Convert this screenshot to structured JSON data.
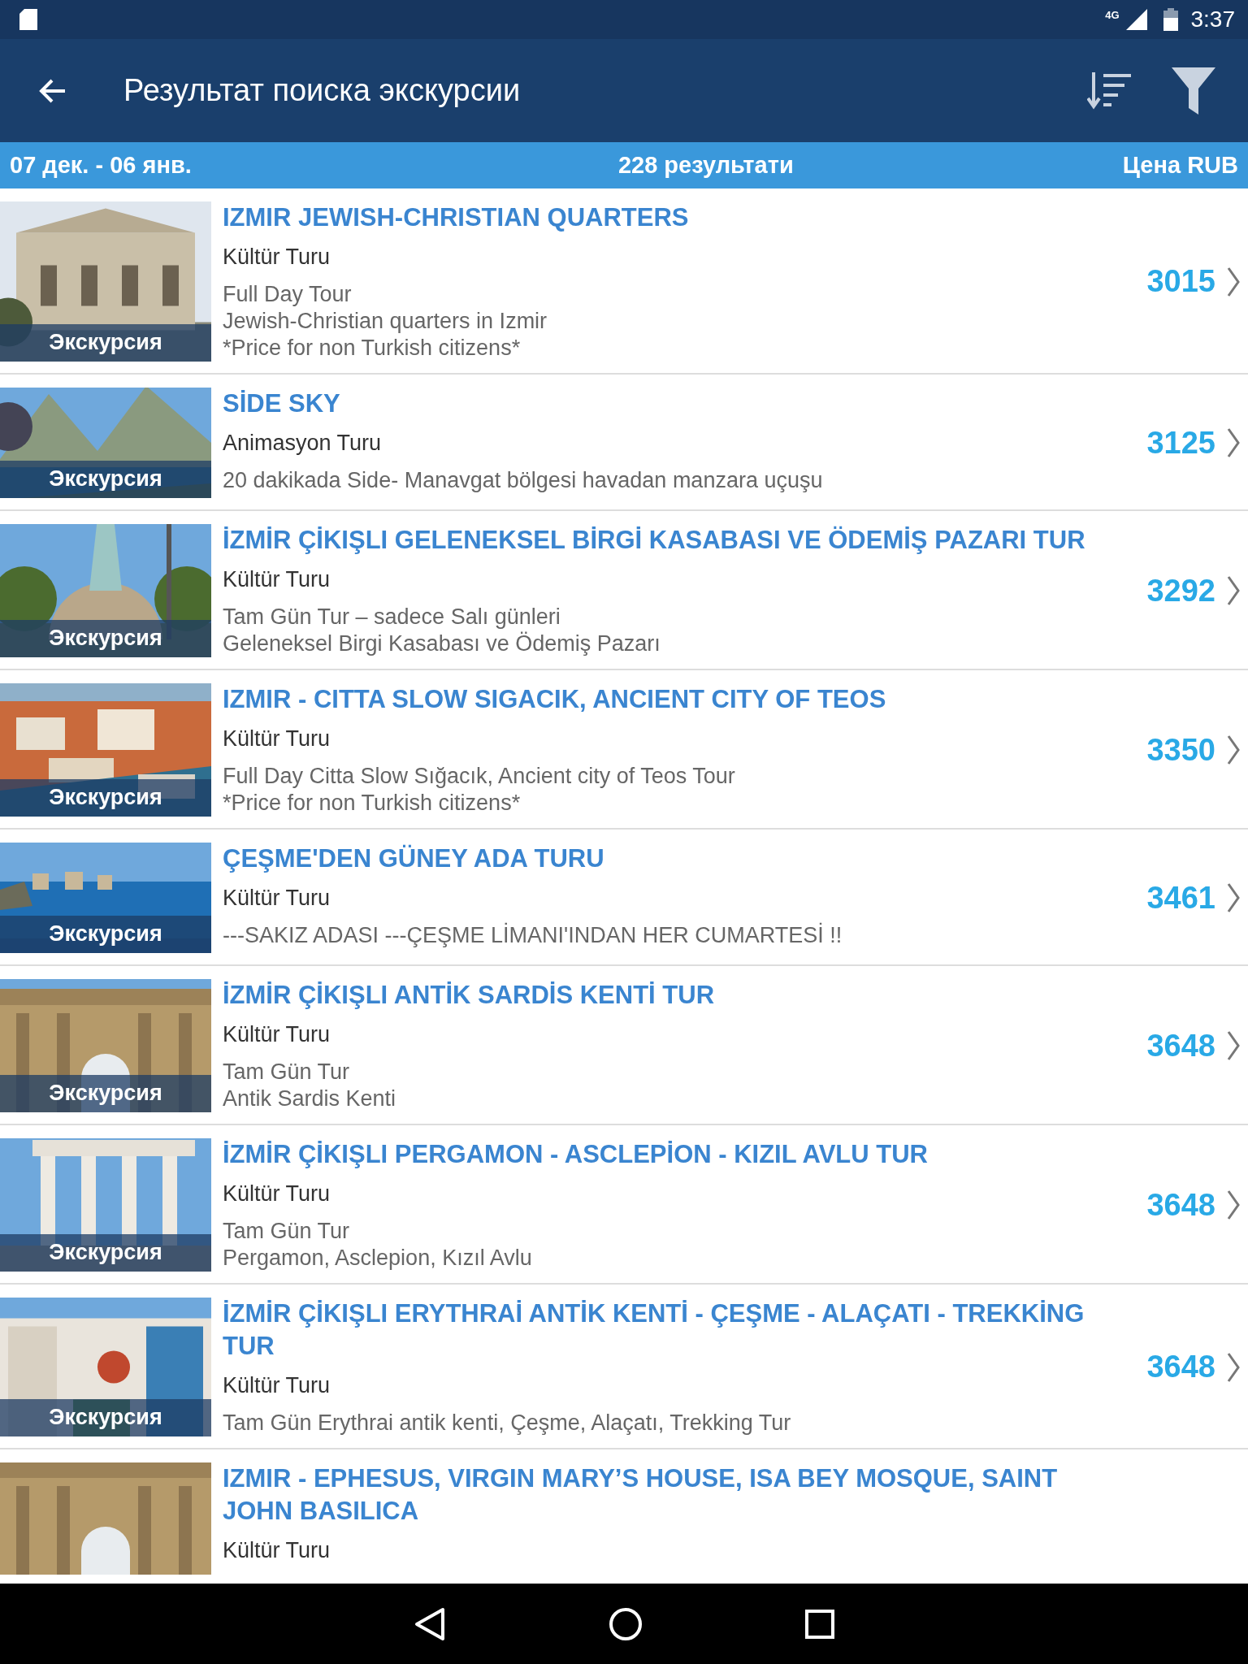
{
  "status_bar": {
    "network": "4G",
    "time": "3:37"
  },
  "toolbar": {
    "title": "Результат поиска экскурсии"
  },
  "summary": {
    "dates": "07 дек. - 06 янв.",
    "count": "228 результати",
    "currency": "Цена RUB"
  },
  "results": [
    {
      "title": "IZMIR JEWISH-CHRISTIAN QUARTERS",
      "category": "Kültür Turu",
      "description": [
        "Full Day Tour",
        "Jewish-Christian quarters in Izmir",
        "*Price for non Turkish citizens*"
      ],
      "price": "3015",
      "tag": "Экскурсия"
    },
    {
      "title": "SİDE SKY",
      "category": "Animasyon Turu",
      "description": [
        "20 dakikada Side- Manavgat bölgesi havadan manzara uçuşu"
      ],
      "price": "3125",
      "tag": "Экскурсия"
    },
    {
      "title": "İZMİR ÇİKIŞLI GELENEKSEL BİRGİ KASABASI VE ÖDEMİŞ PAZARI TUR",
      "category": "Kültür Turu",
      "description": [
        "Tam Gün Tur – sadece Salı günleri",
        "Geleneksel Birgi Kasabası ve Ödemiş Pazarı"
      ],
      "price": "3292",
      "tag": "Экскурсия"
    },
    {
      "title": "IZMIR - CITTA SLOW SIGACIK, ANCIENT CITY OF TEOS",
      "category": "Kültür Turu",
      "description": [
        "Full Day Citta Slow Sığacık, Ancient city of Teos Tour",
        "*Price for non Turkish citizens*"
      ],
      "price": "3350",
      "tag": "Экскурсия"
    },
    {
      "title": "ÇEŞME'DEN GÜNEY ADA TURU",
      "category": "Kültür Turu",
      "description": [
        "---SAKIZ ADASI ---ÇEŞME LİMANI'INDAN HER CUMARTESİ !!"
      ],
      "price": "3461",
      "tag": "Экскурсия"
    },
    {
      "title": "İZMİR ÇİKIŞLI ANTİK SARDİS KENTİ TUR",
      "category": "Kültür Turu",
      "description": [
        "Tam Gün Tur",
        "Antik Sardis Kenti"
      ],
      "price": "3648",
      "tag": "Экскурсия"
    },
    {
      "title": "İZMİR ÇİKIŞLI PERGAMON - ASCLEPİON - KIZIL AVLU TUR",
      "category": "Kültür Turu",
      "description": [
        "Tam Gün Tur",
        "Pergamon, Asclepion, Kızıl Avlu"
      ],
      "price": "3648",
      "tag": "Экскурсия"
    },
    {
      "title": "İZMİR ÇİKIŞLI ERYTHRAİ ANTİK KENTİ - ÇEŞME - ALAÇATI - TREKKİNG TUR",
      "category": "Kültür Turu",
      "description": [
        "Tam Gün Erythrai antik kenti, Çeşme, Alaçatı, Trekking Tur"
      ],
      "price": "3648",
      "tag": "Экскурсия"
    },
    {
      "title": "IZMIR - EPHESUS, VIRGIN MARY’S HOUSE, ISA BEY MOSQUE, SAINT JOHN BASILICA",
      "category": "Kültür Turu"
    }
  ]
}
